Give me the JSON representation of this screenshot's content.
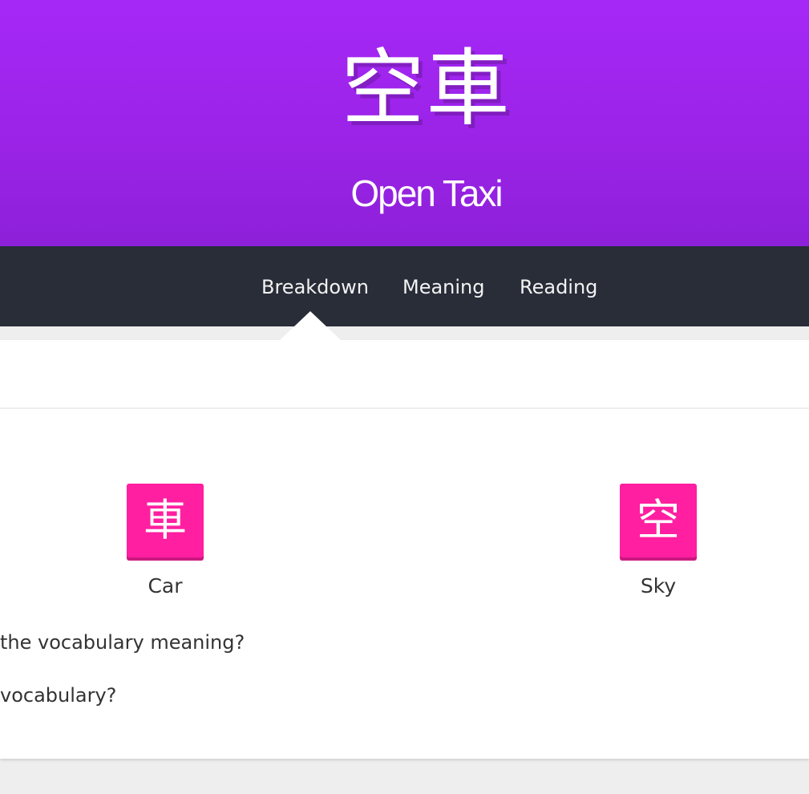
{
  "header": {
    "characters": "空車",
    "meaning": "Open Taxi"
  },
  "nav": {
    "tabs": [
      {
        "label": "Breakdown",
        "active": true
      },
      {
        "label": "Meaning"
      },
      {
        "label": "Reading"
      }
    ]
  },
  "breakdown": {
    "components": [
      {
        "character": "車",
        "meaning": "Car"
      },
      {
        "character": "空",
        "meaning": "Sky"
      }
    ],
    "questions": [
      "the vocabulary meaning?",
      " vocabulary?"
    ]
  },
  "colors": {
    "header_purple": "#a628f7",
    "nav_dark": "#282d38",
    "kanji_pink": "#ff1fa0"
  }
}
